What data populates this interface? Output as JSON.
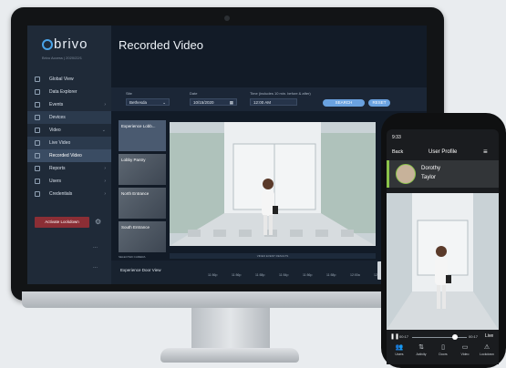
{
  "app": {
    "logo": "brivo",
    "logo_sub": "Brivo Access  |  2020/22/1",
    "page_title": "Recorded Video"
  },
  "sidebar": {
    "items": [
      {
        "label": "Global View",
        "icon": "globe-icon"
      },
      {
        "label": "Data Explorer",
        "icon": "chart-icon"
      },
      {
        "label": "Events",
        "icon": "events-icon",
        "chevron": "›"
      },
      {
        "label": "Devices",
        "icon": "device-icon"
      },
      {
        "label": "Video",
        "icon": "video-icon",
        "chevron": "⌄"
      },
      {
        "label": "Live Video",
        "icon": "live-icon"
      },
      {
        "label": "Recorded Video",
        "icon": "recorded-icon"
      },
      {
        "label": "Reports",
        "icon": "report-icon",
        "chevron": "›"
      },
      {
        "label": "Users",
        "icon": "user-icon",
        "chevron": "›"
      },
      {
        "label": "Credentials",
        "icon": "credential-icon",
        "chevron": "›"
      }
    ],
    "lockdown_label": "Activate Lockdown",
    "more": "..."
  },
  "filters": {
    "site_label": "Site",
    "site_value": "Bethesda",
    "date_label": "Date",
    "date_value": "10/15/2020",
    "time_label": "Time (includes 10 min. before & after)",
    "time_value": "12:00 AM",
    "search_label": "SEARCH",
    "reset_label": "RESET"
  },
  "cameras": [
    {
      "name": "Experience Lobb..."
    },
    {
      "name": "Lobby Pantry"
    },
    {
      "name": "North Entrance"
    },
    {
      "name": "South Entrance"
    }
  ],
  "cameras_footer": "SELECTED CAMERA",
  "timeline": {
    "header": "VIDEO EVENT RESULTS",
    "camera": "Experience Door View",
    "ticks": [
      "11:56p",
      "11:56p",
      "11:58p",
      "11:54p",
      "11:56p",
      "11:58p",
      "12:00a",
      "12:02a"
    ]
  },
  "phone": {
    "time": "9:33",
    "back": "Back",
    "title": "User Profile",
    "first_name": "Dorothy",
    "last_name": "Taylor",
    "elapsed": "00:17",
    "remaining": "00:17",
    "live": "Live",
    "tabs": [
      {
        "label": "Users",
        "icon": "users-icon",
        "glyph": "👥"
      },
      {
        "label": "Activity",
        "icon": "activity-icon",
        "glyph": "⇅"
      },
      {
        "label": "Doors",
        "icon": "door-icon",
        "glyph": "▯"
      },
      {
        "label": "Video",
        "icon": "video-icon",
        "glyph": "▭"
      },
      {
        "label": "Lockdown",
        "icon": "lock-icon",
        "glyph": "⚠"
      }
    ]
  },
  "colors": {
    "accent": "#6aa2e0",
    "lockdown": "#8b2e35",
    "profile_accent": "#8bc34a"
  }
}
